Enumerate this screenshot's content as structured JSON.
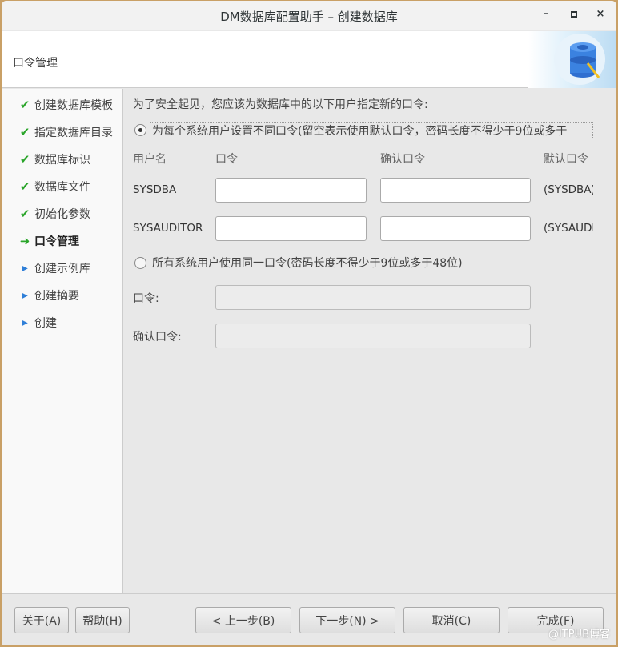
{
  "window": {
    "title": "DM数据库配置助手 – 创建数据库",
    "minimize": "–",
    "maximize": "▫",
    "close": "×"
  },
  "header": {
    "title": "口令管理"
  },
  "sidebar": {
    "items": [
      {
        "label": "创建数据库模板",
        "state": "done"
      },
      {
        "label": "指定数据库目录",
        "state": "done"
      },
      {
        "label": "数据库标识",
        "state": "done"
      },
      {
        "label": "数据库文件",
        "state": "done"
      },
      {
        "label": "初始化参数",
        "state": "done"
      },
      {
        "label": "口令管理",
        "state": "current"
      },
      {
        "label": "创建示例库",
        "state": "pending"
      },
      {
        "label": "创建摘要",
        "state": "pending"
      },
      {
        "label": "创建",
        "state": "pending"
      }
    ]
  },
  "main": {
    "intro": "为了安全起见，您应该为数据库中的以下用户指定新的口令:",
    "option_each": "为每个系统用户设置不同口令(留空表示使用默认口令，密码长度不得少于9位或多于",
    "columns": {
      "user": "用户名",
      "password": "口令",
      "confirm": "确认口令",
      "default": "默认口令"
    },
    "rows": [
      {
        "user": "SYSDBA",
        "password": "",
        "confirm": "",
        "default": "(SYSDBA)"
      },
      {
        "user": "SYSAUDITOR",
        "password": "",
        "confirm": "",
        "default": "(SYSAUDI"
      }
    ],
    "option_same": "所有系统用户使用同一口令(密码长度不得少于9位或多于48位)",
    "same_password_label": "口令:",
    "same_confirm_label": "确认口令:"
  },
  "footer": {
    "about": "关于(A)",
    "help": "帮助(H)",
    "prev": "< 上一步(B)",
    "next": "下一步(N) >",
    "cancel": "取消(C)",
    "finish": "完成(F)"
  },
  "watermark": "@ITPUB博客",
  "colors": {
    "check": "#2aa52a",
    "pending": "#2f7fd8"
  }
}
